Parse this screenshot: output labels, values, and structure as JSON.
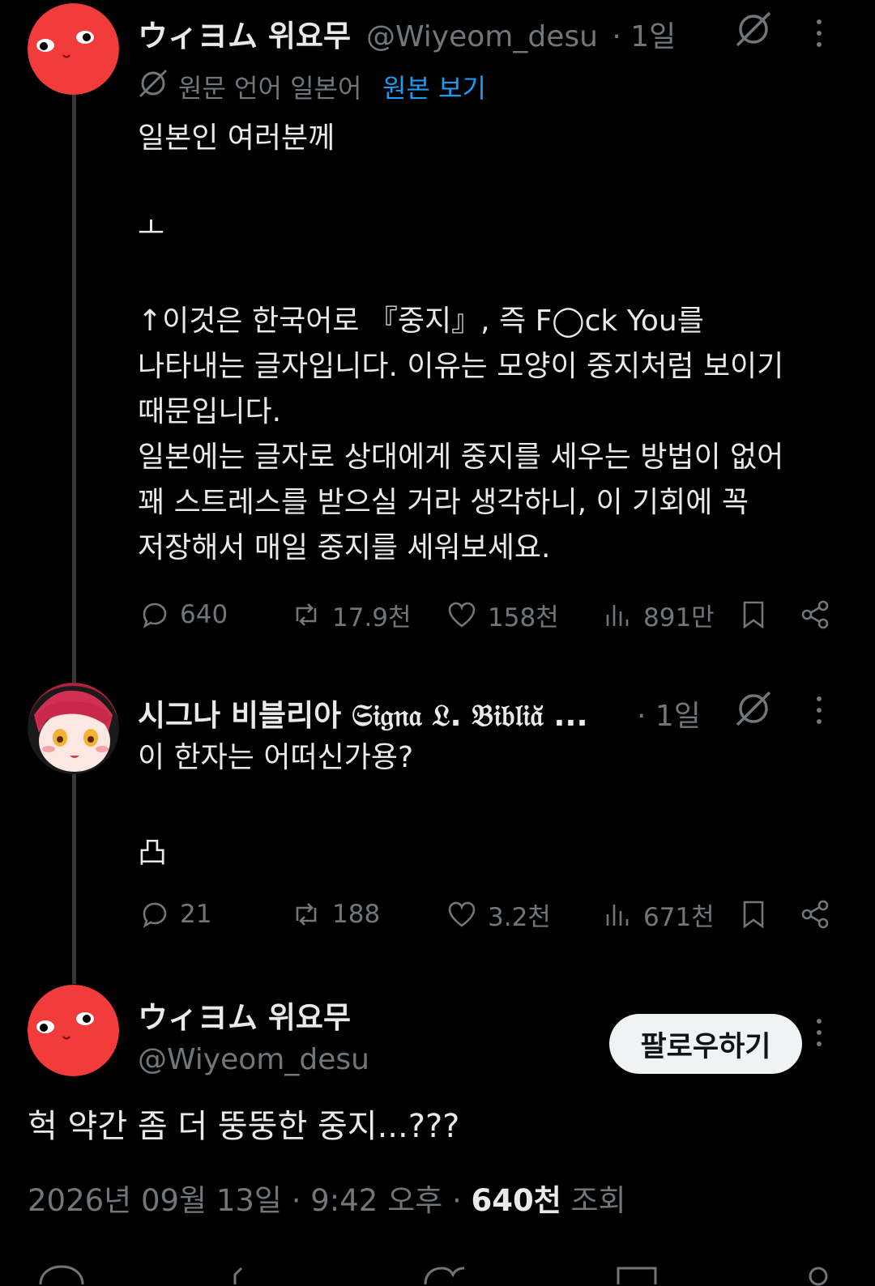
{
  "tweet1": {
    "author_name": "ウィヨム 위요무",
    "handle": "@Wiyeom_desu",
    "time": "· 1일",
    "translation_note": "원문 언어 일본어",
    "show_original": "원본 보기",
    "lines": [
      "일본인 여러분께",
      "",
      "ㅗ",
      "",
      "↑이것은 한국어로 『중지』, 즉 F◯ck You를",
      "나타내는 글자입니다. 이유는 모양이 중지처럼 보이기",
      "때문입니다.",
      "일본에는 글자로 상대에게 중지를 세우는 방법이 없어",
      "꽤 스트레스를 받으실 거라 생각하니, 이 기회에 꼭",
      "저장해서 매일 중지를 세워보세요."
    ],
    "stats": {
      "replies": "640",
      "retweets": "17.9천",
      "likes": "158천",
      "views": "891만"
    }
  },
  "tweet2": {
    "author_name": "시그나 비블리아 𝔖𝔦𝔤𝔫𝔞 𝔏. 𝔅𝔦𝔟𝔩𝔦𝔞̆ ...",
    "time": "· 1일",
    "lines": [
      "이 한자는 어떠신가용?",
      "",
      "凸"
    ],
    "stats": {
      "replies": "21",
      "retweets": "188",
      "likes": "3.2천",
      "views": "671천"
    }
  },
  "tweet3": {
    "author_name": "ウィヨム 위요무",
    "handle": "@Wiyeom_desu",
    "follow_label": "팔로우하기",
    "text": "헉 약간 좀 더 뚱뚱한 중지...???",
    "date": "2026년 09월 13일 · 9:42 오후 · ",
    "views_count": "640천",
    "views_label": " 조회"
  },
  "colors": {
    "background": "#000000",
    "text": "#e7e9ea",
    "muted": "#71767b",
    "link": "#1d9bf0",
    "avatar_red": "#f23b3b"
  }
}
